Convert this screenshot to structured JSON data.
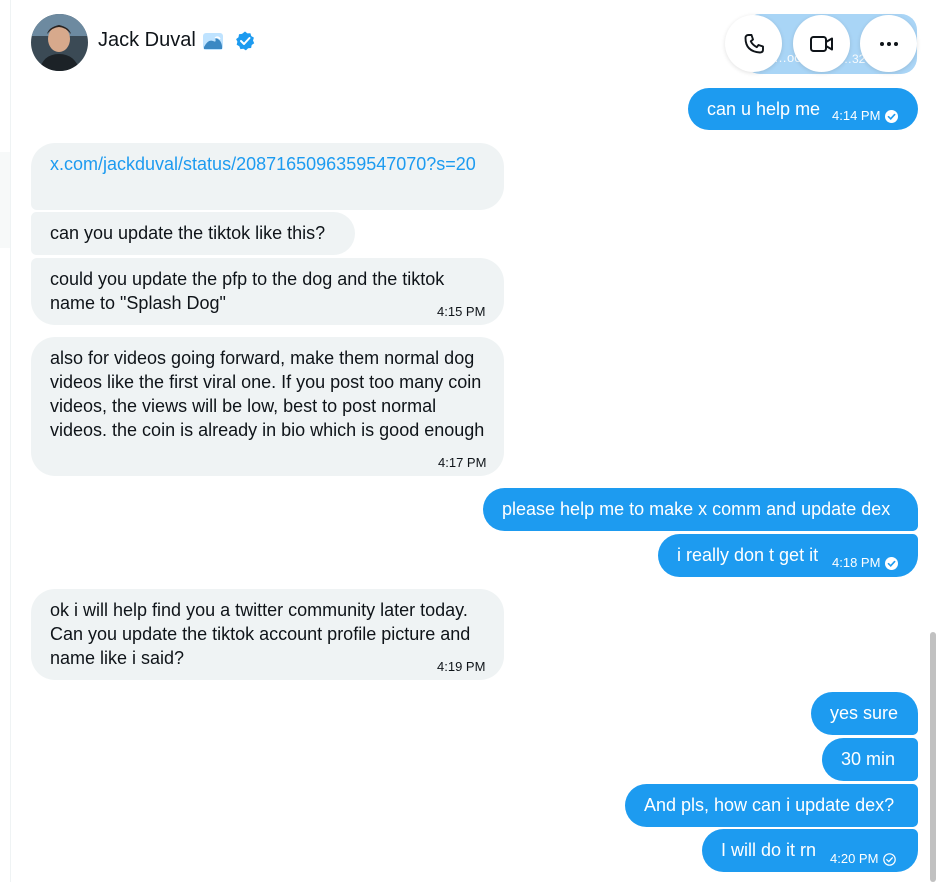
{
  "header": {
    "name": "Jack Duval",
    "name_emoji": "wave",
    "verified": true,
    "avatar_icon": "avatar-photo",
    "actions": [
      {
        "icon": "phone-icon"
      },
      {
        "icon": "video-icon"
      },
      {
        "icon": "more-icon"
      }
    ]
  },
  "peek": {
    "text": "…oo",
    "time": "…32 P"
  },
  "messages": [
    {
      "side": "out",
      "text": "can u help me",
      "time": "4:14 PM",
      "status": "read"
    },
    {
      "side": "in",
      "text": "x.com/jackduval/status/2087165096359547070?s=20",
      "is_link": true,
      "time": ""
    },
    {
      "side": "in",
      "text": "can you update the tiktok like this?",
      "time": ""
    },
    {
      "side": "in",
      "text": "could you update the pfp to the dog and the tiktok name to \"Splash Dog\"",
      "time": "4:15 PM"
    },
    {
      "side": "in",
      "text": "also for videos going forward, make them normal dog videos like the first viral one. If you post too many coin videos, the views will be low, best to post normal videos. the coin is already in bio which is good enough",
      "time": "4:17 PM"
    },
    {
      "side": "out",
      "text": "please help me to make x comm and update dex",
      "time": ""
    },
    {
      "side": "out",
      "text": "i really don t get it",
      "time": "4:18 PM",
      "status": "read"
    },
    {
      "side": "in",
      "text": "ok i will help find you a twitter community later today. Can you update the tiktok account profile picture and name like i said?",
      "time": "4:19 PM"
    },
    {
      "side": "out",
      "text": "yes sure",
      "time": ""
    },
    {
      "side": "out",
      "text": "30 min",
      "time": ""
    },
    {
      "side": "out",
      "text": "And pls, how can i update dex?",
      "time": ""
    },
    {
      "side": "out",
      "text": "I will do it rn",
      "time": "4:20 PM",
      "status": "sent"
    }
  ],
  "colors": {
    "accent": "#1d9bf0",
    "incoming_bg": "#eff3f4",
    "text": "#0f1419"
  }
}
